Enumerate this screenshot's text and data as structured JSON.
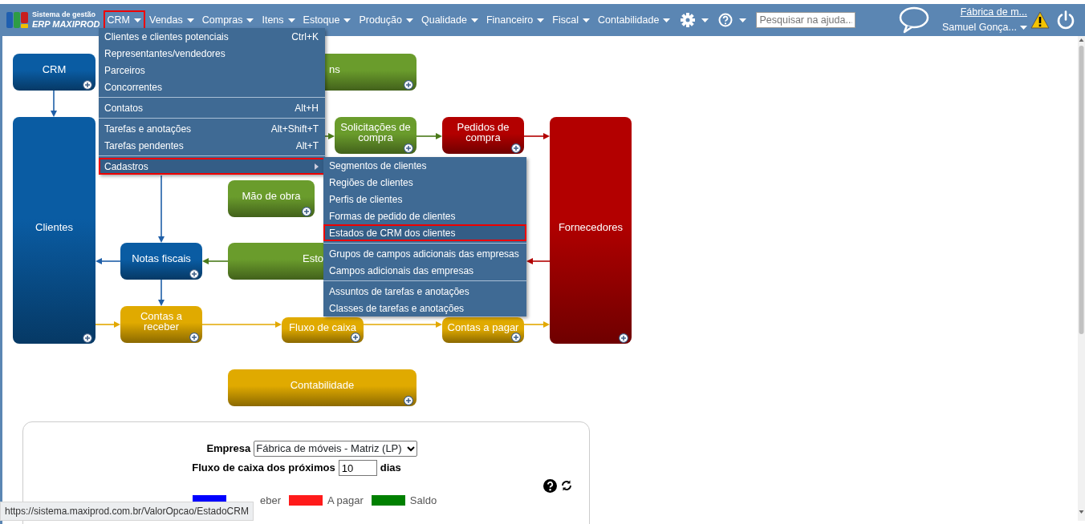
{
  "logo": {
    "line_1": "Sistema de gestão",
    "line_2": "ERP MAXIPROD"
  },
  "menu": [
    {
      "label": "CRM",
      "selected": true
    },
    {
      "label": "Vendas",
      "selected": false
    },
    {
      "label": "Compras",
      "selected": false
    },
    {
      "label": "Itens",
      "selected": false
    },
    {
      "label": "Estoque",
      "selected": false
    },
    {
      "label": "Produção",
      "selected": false
    },
    {
      "label": "Qualidade",
      "selected": false
    },
    {
      "label": "Financeiro",
      "selected": false
    },
    {
      "label": "Fiscal",
      "selected": false
    },
    {
      "label": "Contabilidade",
      "selected": false
    }
  ],
  "search": {
    "placeholder": "Pesquisar na ajuda..."
  },
  "user": {
    "company": "Fábrica de m...",
    "name": "Samuel Gonça..."
  },
  "diagram": {
    "nodes": [
      {
        "label": "CRM",
        "color": "#0a5ca3"
      },
      {
        "label": "ns",
        "color": "#6a9c2c"
      },
      {
        "label": "Clientes",
        "color": "#0a5ca3"
      },
      {
        "label": "Solicitações de compra",
        "color": "#6a9c2c"
      },
      {
        "label": "Pedidos de compra",
        "color": "#b30000"
      },
      {
        "label": "Fornecedores",
        "color": "#b30000"
      },
      {
        "label": "Mão de obra",
        "color": "#6a9c2c"
      },
      {
        "label": "Notas fiscais",
        "color": "#0a5ca3"
      },
      {
        "label": "Esto",
        "color": "#6a9c2c"
      },
      {
        "label": "Contas a receber",
        "color": "#e0aa00"
      },
      {
        "label": "Fluxo de caixa",
        "color": "#e0aa00"
      },
      {
        "label": "Contas a pagar",
        "color": "#e0aa00"
      },
      {
        "label": "Contabilidade",
        "color": "#e0aa00"
      }
    ]
  },
  "crm_menu": {
    "groups": [
      [
        {
          "label": "Clientes e clientes potenciais",
          "shortcut": "Ctrl+K",
          "kind": "command",
          "selected": false
        },
        {
          "label": "Representantes/vendedores",
          "kind": "command",
          "selected": false
        },
        {
          "label": "Parceiros",
          "kind": "command",
          "selected": false
        },
        {
          "label": "Concorrentes",
          "kind": "command",
          "selected": false
        }
      ],
      [
        {
          "label": "Contatos",
          "shortcut": "Alt+H",
          "kind": "command",
          "selected": false
        }
      ],
      [
        {
          "label": "Tarefas e anotações",
          "shortcut": "Alt+Shift+T",
          "kind": "command",
          "selected": false
        },
        {
          "label": "Tarefas pendentes",
          "shortcut": "Alt+T",
          "kind": "command",
          "selected": false
        }
      ],
      [
        {
          "label": "Cadastros",
          "kind": "submenu",
          "selected": true
        }
      ]
    ]
  },
  "submenu": {
    "groups": [
      [
        {
          "label": "Segmentos de clientes",
          "selected": false
        },
        {
          "label": "Regiões de clientes",
          "selected": false
        },
        {
          "label": "Perfis de clientes",
          "selected": false
        },
        {
          "label": "Formas de pedido de clientes",
          "selected": false
        },
        {
          "label": "Estados de CRM dos clientes",
          "selected": true
        }
      ],
      [
        {
          "label": "Grupos de campos adicionais das empresas",
          "selected": false
        },
        {
          "label": "Campos adicionais das empresas",
          "selected": false
        }
      ],
      [
        {
          "label": "Assuntos de tarefas e anotações",
          "selected": false
        },
        {
          "label": "Classes de tarefas e anotações",
          "selected": false
        }
      ]
    ]
  },
  "cash_flow": {
    "company_label": "Empresa",
    "company_value": "Fábrica de móveis - Matriz (LP)",
    "days_label": "Fluxo de caixa dos próximos",
    "days_value": "10",
    "days_unit": "dias",
    "legend": [
      {
        "label": "eber",
        "color": "#0000ff"
      },
      {
        "label": "A pagar",
        "color": "#ff1a1a"
      },
      {
        "label": "Saldo",
        "color": "#008000"
      }
    ]
  },
  "status_url": "https://sistema.maxiprod.com.br/ValorOpcao/EstadoCRM"
}
